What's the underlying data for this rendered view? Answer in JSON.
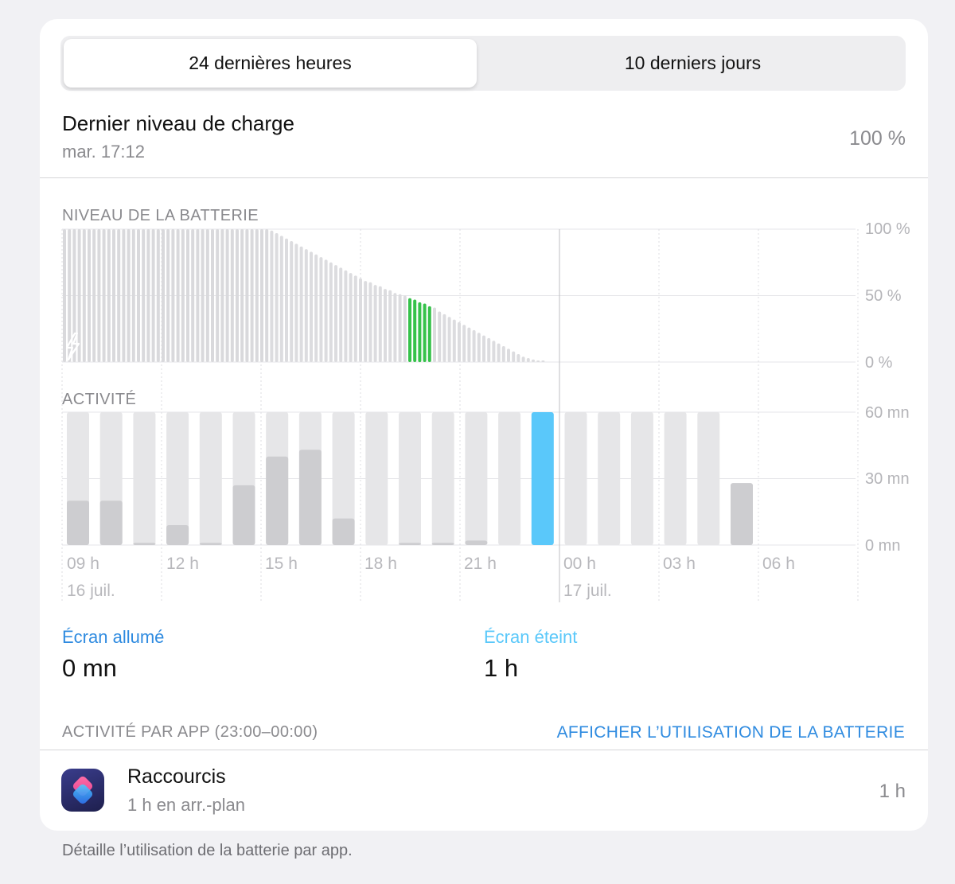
{
  "segmented": {
    "tabs": [
      {
        "label": "24 dernières heures",
        "selected": true
      },
      {
        "label": "10 derniers jours",
        "selected": false
      }
    ]
  },
  "last_charge": {
    "title": "Dernier niveau de charge",
    "time": "mar. 17:12",
    "value": "100 %"
  },
  "battery_section": {
    "title": "NIVEAU DE LA BATTERIE",
    "y_labels": [
      "100 %",
      "50 %",
      "0 %"
    ]
  },
  "activity_section": {
    "title": "ACTIVITÉ",
    "y_labels": [
      "60 mn",
      "30 mn",
      "0 mn"
    ]
  },
  "x_axis": {
    "hours": [
      "09 h",
      "12 h",
      "15 h",
      "18 h",
      "21 h",
      "00 h",
      "03 h",
      "06 h"
    ],
    "dates": [
      "16 juil.",
      "17 juil."
    ]
  },
  "stats": {
    "screen_on_label": "Écran allumé",
    "screen_on_value": "0 mn",
    "screen_off_label": "Écran éteint",
    "screen_off_value": "1 h"
  },
  "app_activity": {
    "title": "ACTIVITÉ PAR APP (23:00–00:00)",
    "link": "AFFICHER L’UTILISATION DE LA BATTERIE",
    "apps": [
      {
        "name": "Raccourcis",
        "detail": "1 h en arr.-plan",
        "value": "1 h",
        "icon": "shortcuts-icon"
      }
    ]
  },
  "footer": "Détaille l’utilisation de la batterie par app.",
  "colors": {
    "battery_bar": "#dcdcdf",
    "battery_highlight": "#35c24a",
    "activity_track": "#e6e6e8",
    "activity_fill": "#cdcdd0",
    "activity_selected": "#5ac8fa",
    "link": "#2f8be0",
    "screen_off_label": "#5ac8fa"
  },
  "chart_data": [
    {
      "type": "bar",
      "title": "NIVEAU DE LA BATTERIE",
      "ylim": [
        0,
        100
      ],
      "y_unit": "%",
      "charging_until_index": 41,
      "highlight_range": [
        70,
        74
      ],
      "values": [
        100,
        100,
        100,
        100,
        100,
        100,
        100,
        100,
        100,
        100,
        100,
        100,
        100,
        100,
        100,
        100,
        100,
        100,
        100,
        100,
        100,
        100,
        100,
        100,
        100,
        100,
        100,
        100,
        100,
        100,
        100,
        100,
        100,
        100,
        100,
        100,
        100,
        100,
        100,
        100,
        100,
        100,
        99,
        97,
        95,
        93,
        91,
        89,
        87,
        85,
        83,
        81,
        79,
        77,
        75,
        73,
        71,
        69,
        67,
        65,
        63,
        61,
        60,
        58,
        57,
        55,
        54,
        52,
        51,
        50,
        48,
        47,
        45,
        44,
        42,
        41,
        38,
        36,
        34,
        32,
        30,
        28,
        26,
        24,
        22,
        20,
        18,
        16,
        14,
        12,
        10,
        8,
        6,
        4,
        3,
        2,
        1,
        1
      ]
    },
    {
      "type": "bar",
      "title": "ACTIVITÉ",
      "ylim": [
        0,
        60
      ],
      "y_unit": "mn",
      "selected_index": 14,
      "series": [
        {
          "name": "used",
          "values": [
            20,
            20,
            1,
            9,
            1,
            27,
            40,
            43,
            12,
            0,
            1,
            1,
            2,
            0,
            60,
            0,
            0,
            0,
            0,
            0,
            28
          ]
        },
        {
          "name": "window",
          "values": [
            60,
            60,
            60,
            60,
            60,
            60,
            60,
            60,
            60,
            60,
            60,
            60,
            60,
            60,
            60,
            60,
            60,
            60,
            60,
            60,
            28
          ]
        }
      ]
    }
  ]
}
